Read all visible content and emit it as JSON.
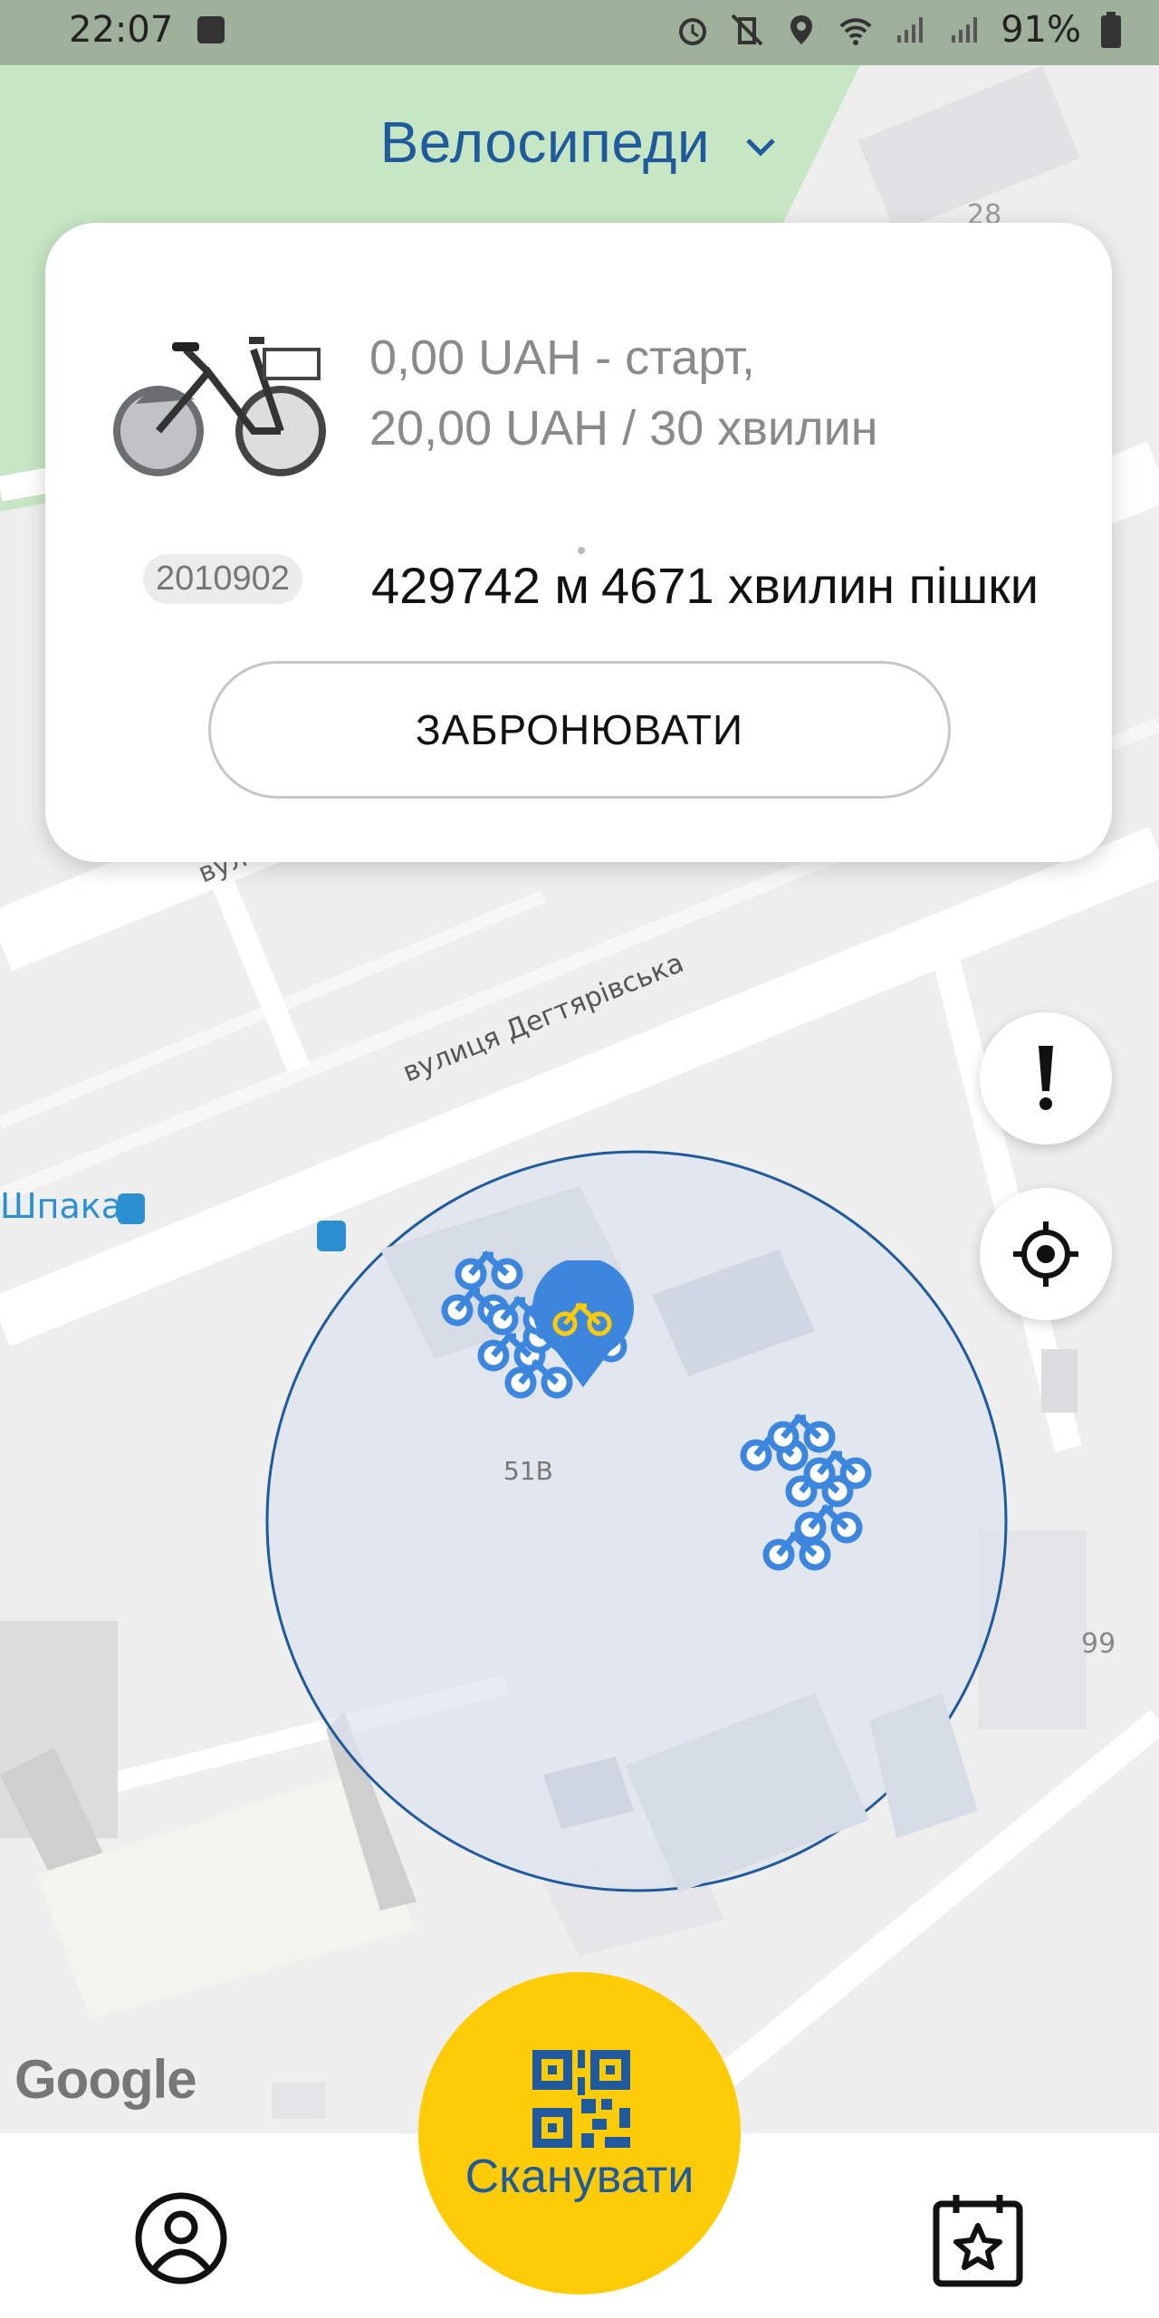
{
  "status": {
    "time": "22:07",
    "battery": "91%"
  },
  "header": {
    "title": "Велосипеди"
  },
  "card": {
    "tariff_line1": "0,00 UAH - старт,",
    "tariff_line2": "20,00 UAH / 30 хвилин",
    "bike_id": "2010902",
    "distance": "429742 м",
    "walk_time": "4671 хвилин пішки",
    "reserve_label": "ЗАБРОНЮВАТИ"
  },
  "map": {
    "street": "вулиця Дегтярівська",
    "street_partial": "вул",
    "stop_name": "Шпака",
    "building_51v": "51В",
    "building_99": "99",
    "building_28": "28",
    "attribution": "Google"
  },
  "bottom": {
    "scan_label": "Сканувати"
  },
  "colors": {
    "brand_blue": "#1e5a9c",
    "accent_yellow": "#fecc07",
    "bike_blue": "#3c86dd"
  },
  "icons": [
    "alert-icon",
    "locate-icon",
    "qr-icon",
    "profile-icon",
    "calendar-star-icon",
    "bike-marker-icon",
    "chevron-down-icon"
  ]
}
